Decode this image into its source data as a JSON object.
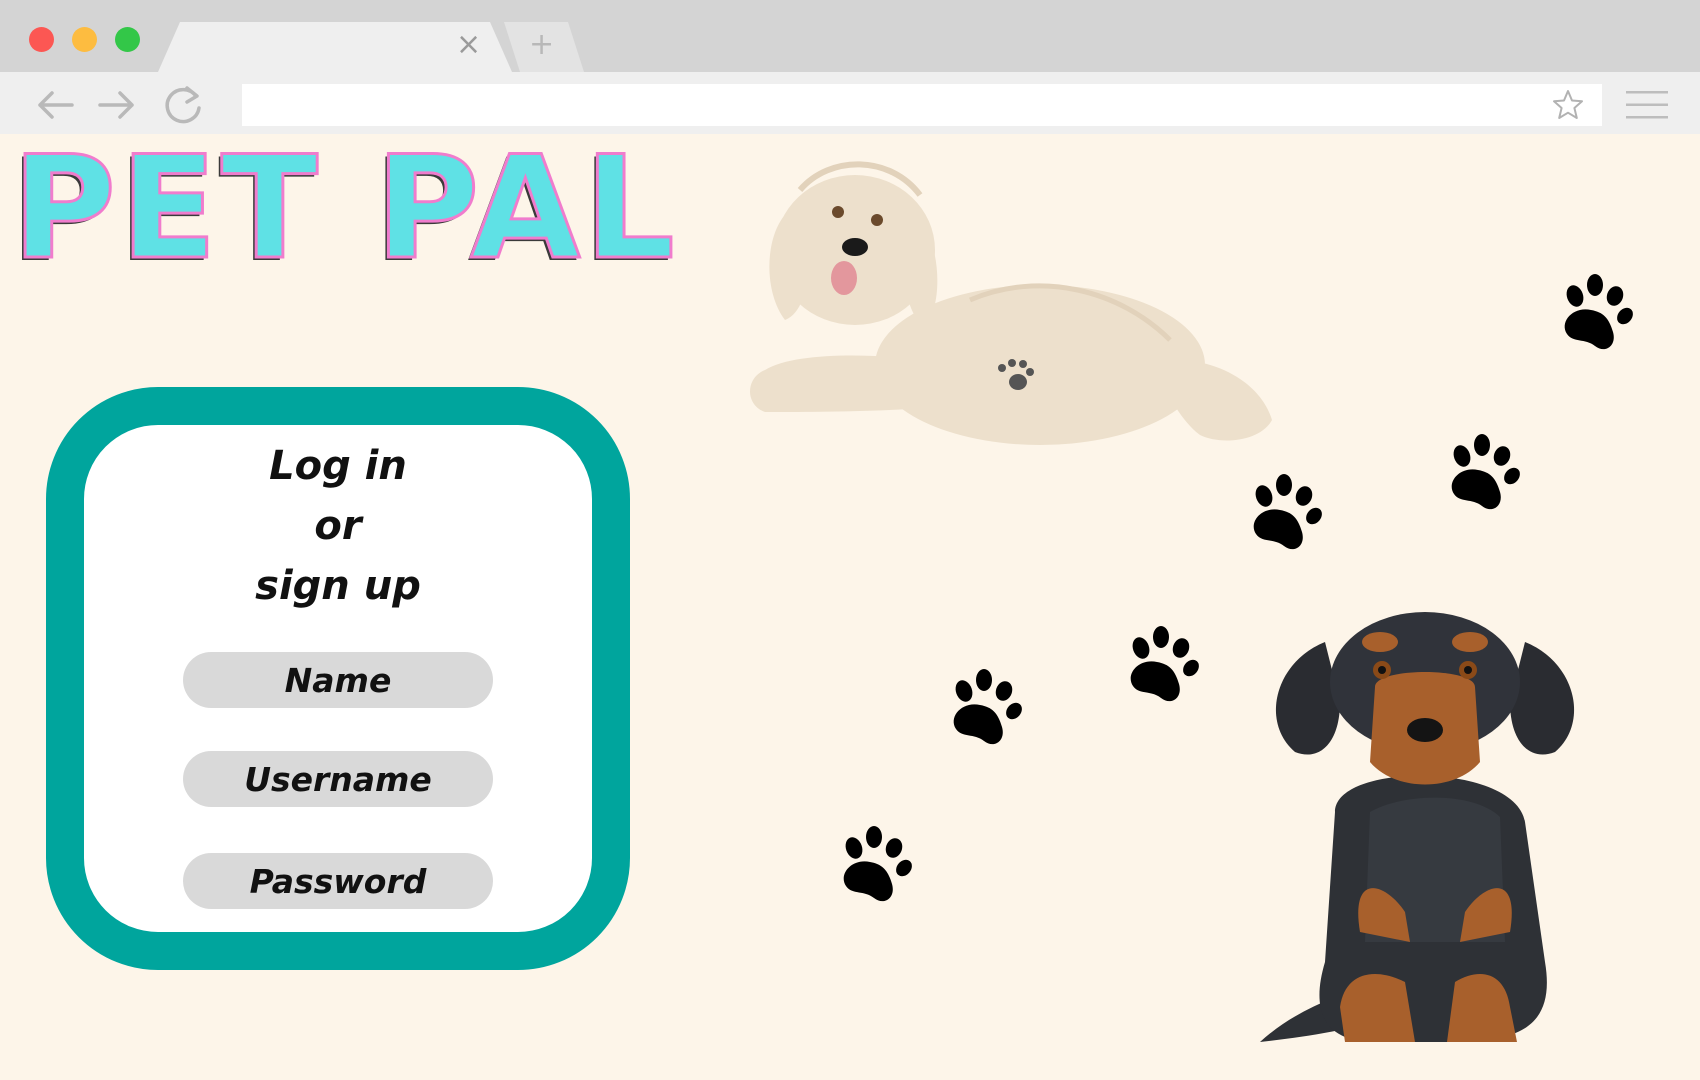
{
  "browser": {
    "tab_close_glyph": "×",
    "new_tab_glyph": "+",
    "address": "",
    "traffic_lights": [
      "#fc5753",
      "#fdbc40",
      "#33c748"
    ]
  },
  "page": {
    "logo_text": "PET PAL",
    "login_card": {
      "heading_lines": [
        "Log in",
        "or",
        "sign up"
      ],
      "fields": [
        {
          "placeholder": "Name",
          "value": ""
        },
        {
          "placeholder": "Username",
          "value": ""
        },
        {
          "placeholder": "Password",
          "value": ""
        }
      ]
    },
    "illustrations": [
      "lying-cream-dog",
      "sitting-black-tan-dachshund",
      "paw-prints"
    ]
  },
  "colors": {
    "background": "#fdf5e9",
    "card_border": "#00a59d",
    "logo_fill": "#5fe1e5",
    "logo_outline": "#f07ccd",
    "field_fill": "#d9d9d9"
  }
}
